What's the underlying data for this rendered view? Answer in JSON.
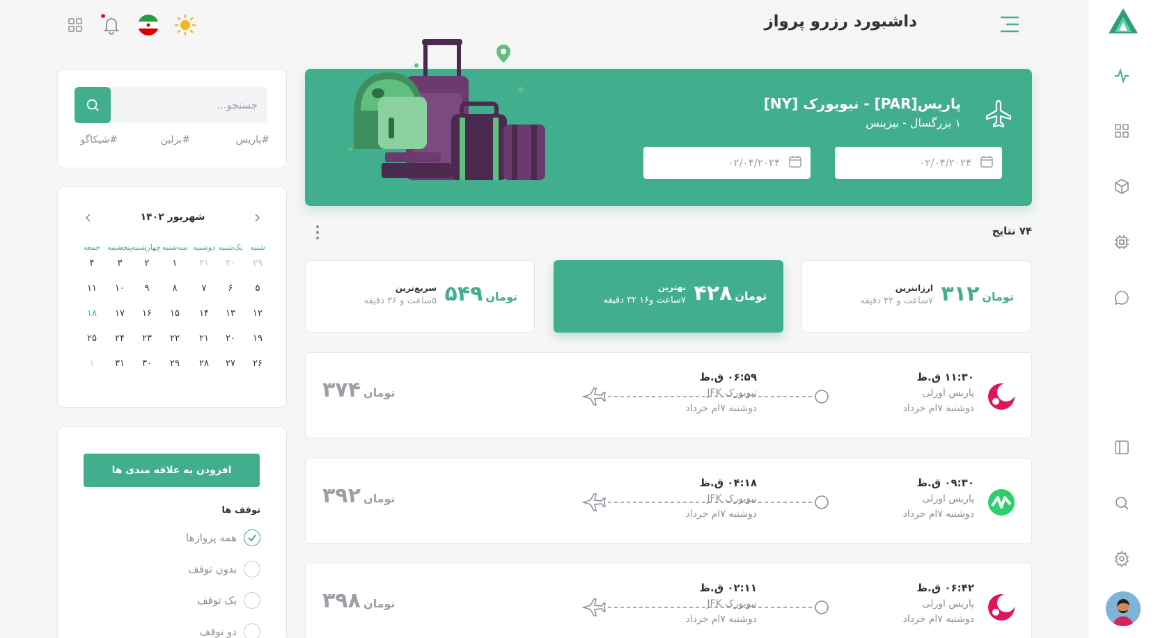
{
  "app": {
    "title": "داشبورد رزرو پرواز"
  },
  "hero": {
    "route": "پاریس[PAR] - نیویورک [NY]",
    "passengers": "۱ بزرگسال - بیزینس",
    "date_from": "۰۲/۰۴/۲۰۲۴",
    "date_to": "۰۲/۰۴/۲۰۲۴"
  },
  "results": {
    "count": "۷۴ نتایج"
  },
  "sort_options": [
    {
      "price": "۳۱۲",
      "currency": "تومان",
      "label": "ارزانترین",
      "duration": "۷ساعت و ۳۲ دقیقه",
      "active": false
    },
    {
      "price": "۴۲۸",
      "currency": "تومان",
      "label": "بهترین",
      "duration": "۷ساعت و۱۶ ۳۲ دقیقه",
      "active": true
    },
    {
      "price": "۵۴۹",
      "currency": "تومان",
      "label": "سریع‌ترین",
      "duration": "۵ساعت و ۳۶ دقیقه",
      "active": false
    }
  ],
  "flights": [
    {
      "airline_color": "#e0155d",
      "airline_icon": "moon-logo-icon",
      "dep_time": "۱۱:۳۰ ق.ظ",
      "dep_place": "پاریس اورلی",
      "dep_date": "دوشنبه ۷ام خرداد",
      "arr_time": "۰۶:۵۹ ق.ظ",
      "arr_place": "نیویورک JFK",
      "arr_date": "دوشنبه ۷ام خرداد",
      "price": "۳۷۴",
      "currency": "تومان"
    },
    {
      "airline_color": "#2bd06a",
      "airline_icon": "zigzag-logo-icon",
      "dep_time": "۰۹:۳۰ ق.ظ",
      "dep_place": "پاریس اورلی",
      "dep_date": "دوشنبه ۷ام خرداد",
      "arr_time": "۰۴:۱۸ ق.ظ",
      "arr_place": "نیویورک JFK",
      "arr_date": "دوشنبه ۷ام خرداد",
      "price": "۳۹۲",
      "currency": "تومان"
    },
    {
      "airline_color": "#e0155d",
      "airline_icon": "moon-logo-icon",
      "dep_time": "۰۶:۴۲ ق.ظ",
      "dep_place": "پاریس اورلی",
      "dep_date": "دوشنبه ۷ام خرداد",
      "arr_time": "۰۲:۱۱ ق.ظ",
      "arr_place": "نیویورک JFK",
      "arr_date": "دوشنبه ۷ام خرداد",
      "price": "۳۹۸",
      "currency": "تومان"
    }
  ],
  "search": {
    "placeholder": "جستجو...",
    "tags": [
      "#پاریس",
      "#برلین",
      "#شیکاگو"
    ]
  },
  "calendar": {
    "month": "شهریور ۱۴۰۲",
    "weekdays": [
      "شنبه",
      "یک‌شنبه",
      "دوشنبه",
      "سه‌شنبه",
      "چهارشنبه",
      "پنجشنبه",
      "جمعه"
    ],
    "weeks": [
      [
        "۲۹",
        "۳۰",
        "۳۱",
        "۱",
        "۲",
        "۳",
        "۴"
      ],
      [
        "۵",
        "۶",
        "۷",
        "۸",
        "۹",
        "۱۰",
        "۱۱"
      ],
      [
        "۱۲",
        "۱۳",
        "۱۴",
        "۱۵",
        "۱۶",
        "۱۷",
        "۱۸"
      ],
      [
        "۱۹",
        "۲۰",
        "۲۱",
        "۲۲",
        "۲۳",
        "۲۴",
        "۲۵"
      ],
      [
        "۲۶",
        "۲۷",
        "۲۸",
        "۲۹",
        "۳۰",
        "۳۱",
        "۱"
      ]
    ]
  },
  "filters": {
    "add_button": "افزودن به علاقه مندی ها",
    "stops_title": "توقف ها",
    "options": [
      {
        "label": "همه پروازها",
        "checked": true
      },
      {
        "label": "بدون توقف",
        "checked": false
      },
      {
        "label": "یک توقف",
        "checked": false
      },
      {
        "label": "دو توقف",
        "checked": false
      }
    ]
  },
  "colors": {
    "accent": "#41ae8e",
    "text": "#333333",
    "muted": "#8a8f98"
  }
}
